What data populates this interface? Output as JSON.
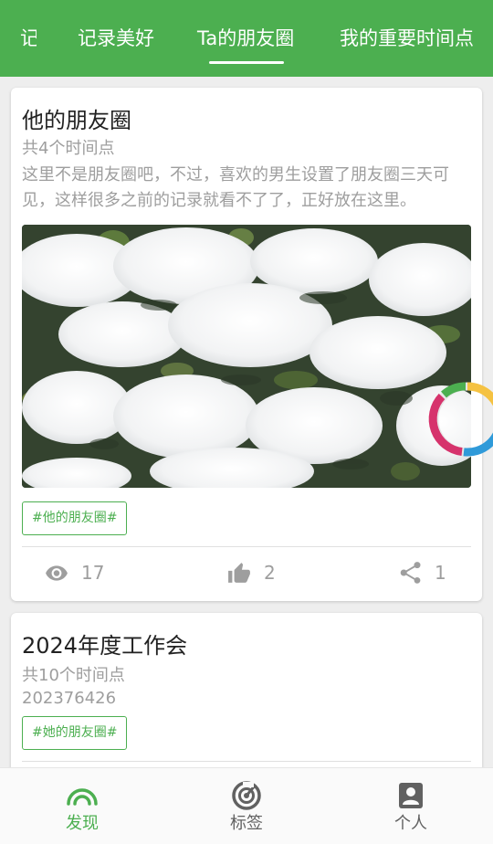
{
  "colors": {
    "primary": "#4caf50",
    "muted": "#9e9e9e",
    "icon_gray": "#616161"
  },
  "tabs": [
    {
      "label": "记"
    },
    {
      "label": "记录美好"
    },
    {
      "label": "Ta的朋友圈",
      "selected": true
    },
    {
      "label": "我的重要时间点"
    }
  ],
  "cards": [
    {
      "title": "他的朋友圈",
      "count": "共4个时间点",
      "description": "这里不是朋友圈吧，不过，喜欢的男生设置了朋友圈三天可见，这样很多之前的记录就看不了了，正好放在这里。",
      "image_icon": "snow-covered-shrub-photo",
      "tag": "#他的朋友圈#",
      "views": "17",
      "likes": "2",
      "shares": "1"
    },
    {
      "title": "2024年度工作会",
      "count": "共10个时间点",
      "description": "202376426",
      "tag": "#她的朋友圈#"
    }
  ],
  "bottom_nav": [
    {
      "label": "发现",
      "icon": "discover-arc-icon",
      "selected": true
    },
    {
      "label": "标签",
      "icon": "radar-icon"
    },
    {
      "label": "个人",
      "icon": "person-icon"
    }
  ]
}
